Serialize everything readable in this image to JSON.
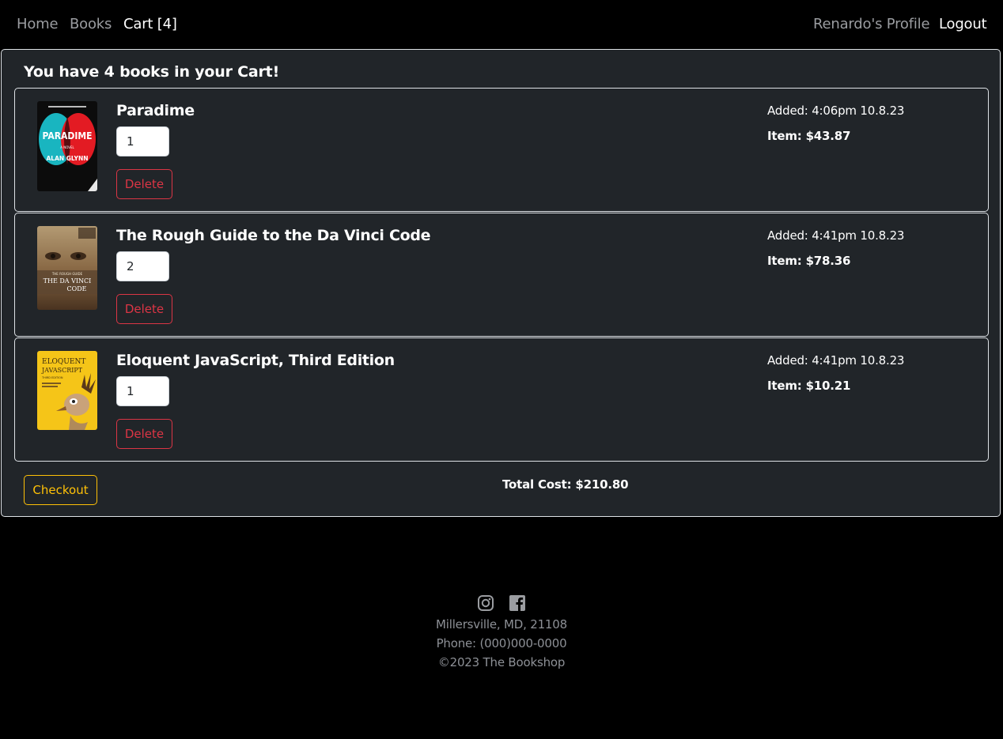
{
  "nav": {
    "home": "Home",
    "books": "Books",
    "cart": "Cart [4]",
    "profile": "Renardo's Profile",
    "logout": "Logout"
  },
  "cart": {
    "heading": "You have 4 books in your Cart!",
    "items": [
      {
        "title": "Paradime",
        "quantity": "1",
        "added": "Added: 4:06pm 10.8.23",
        "price": "Item: $43.87",
        "delete_label": "Delete",
        "cover": {
          "title": "PARADIME",
          "author": "ALAN GLYNN",
          "tag": "A NOVEL"
        }
      },
      {
        "title": "The Rough Guide to the Da Vinci Code",
        "quantity": "2",
        "added": "Added: 4:41pm 10.8.23",
        "price": "Item: $78.36",
        "delete_label": "Delete",
        "cover": {
          "line1": "THE DA VINCI",
          "line2": "CODE",
          "tag": "THE ROUGH GUIDE"
        }
      },
      {
        "title": "Eloquent JavaScript, Third Edition",
        "quantity": "1",
        "added": "Added: 4:41pm 10.8.23",
        "price": "Item: $10.21",
        "delete_label": "Delete",
        "cover": {
          "line1": "ELOQUENT",
          "line2": "JAVASCRIPT",
          "tag": "THIRD EDITION"
        }
      }
    ],
    "checkout_label": "Checkout",
    "total": "Total Cost: $210.80"
  },
  "footer": {
    "icons": [
      "instagram-icon",
      "facebook-icon"
    ],
    "address": "Millersville, MD, 21108",
    "phone": "Phone: (000)000-0000",
    "copyright": "©2023 The Bookshop"
  },
  "colors": {
    "background": "#000000",
    "card": "#212529",
    "danger": "#dc3545",
    "warning": "#ffc107",
    "muted": "#9a9ca0"
  }
}
